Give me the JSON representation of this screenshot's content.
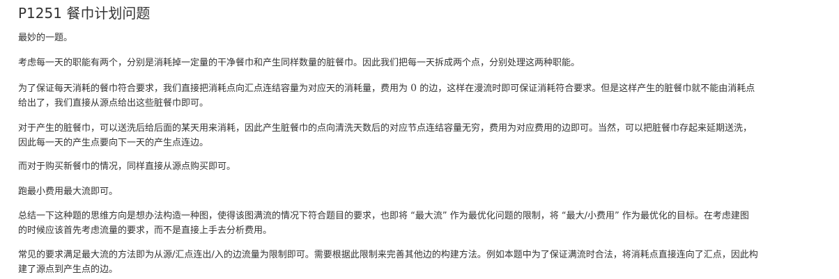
{
  "article": {
    "title": "P1251 餐巾计划问题",
    "paragraphs": {
      "p1": [
        "最妙的一题。"
      ],
      "p2": [
        "考虑每一天的职能有两个，分别是消耗掉一定量的干净餐巾和产生同样数量的脏餐巾。因此我们把每一天拆成两个点，分别处理这两种职能。"
      ],
      "p3": {
        "line1_before": "为了保证每天消耗的餐巾符合要求，我们直接把消耗点向汇点连结容量为对应天的消耗量，费用为 ",
        "line1_math": "0",
        "line1_after": " 的边，这样在漫流时即可保证消耗符合要求。但是这样产生的脏餐巾就不能由消耗点",
        "line2": "给出了，我们直接从源点给出这些脏餐巾即可。"
      },
      "p4": [
        "对于产生的脏餐巾，可以送洗后给后面的某天用来消耗，因此产生脏餐巾的点向清洗天数后的对应节点连结容量无穷，费用为对应费用的边即可。当然，可以把脏餐巾存起来延期送洗，",
        "因此每一天的产生点要向下一天的产生点连边。"
      ],
      "p5": [
        "而对于购买新餐巾的情况，同样直接从源点购买即可。"
      ],
      "p6": [
        "跑最小费用最大流即可。"
      ],
      "p7": [
        "总结一下这种题的思维方向是想办法构造一种图，使得该图满流的情况下符合题目的要求，也即将 “最大流” 作为最优化问题的限制，将 “最大/小费用” 作为最优化的目标。在考虑建图",
        "的时候应该首先考虑流量的要求，而不是直接上手去分析费用。"
      ],
      "p8": [
        "常见的要求满足最大流的方法即为从源/汇点连出/入的边流量为限制即可。需要根据此限制来完善其他边的构建方法。例如本题中为了保证满流时合法，将消耗点直接连向了汇点，因此构",
        "建了源点到产生点的边。"
      ]
    }
  },
  "colors": {
    "text": "#333333",
    "background": "#ffffff"
  }
}
